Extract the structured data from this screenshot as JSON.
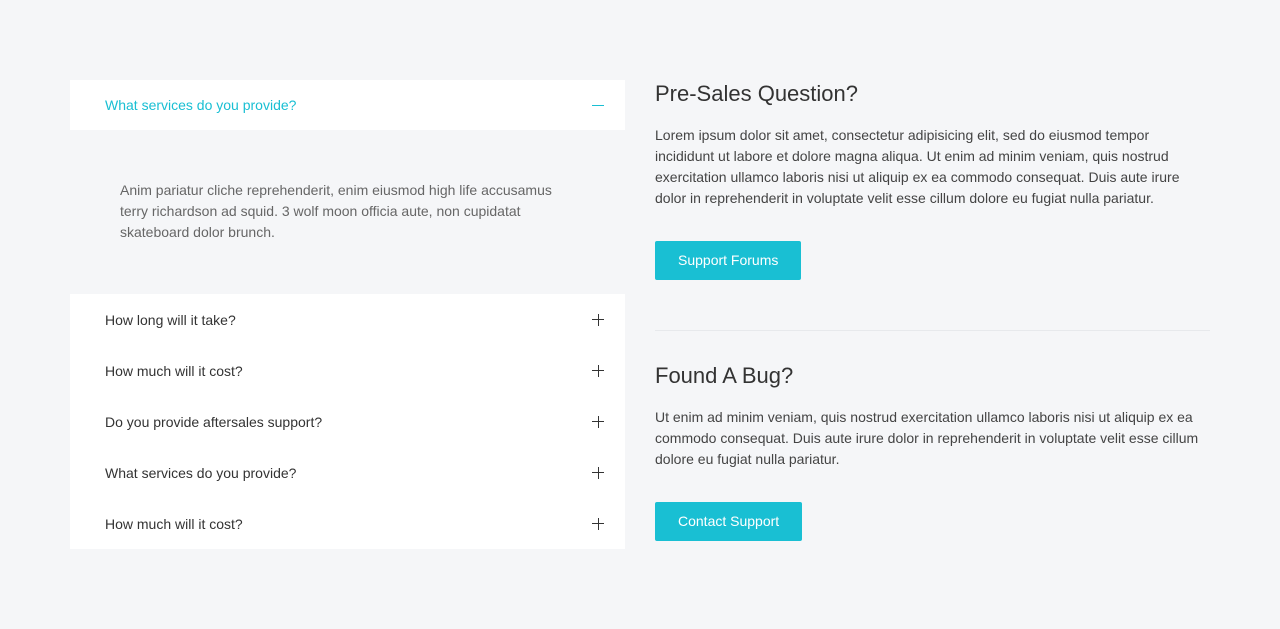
{
  "faq": {
    "active": {
      "question": "What services do you provide?",
      "answer": "Anim pariatur cliche reprehenderit, enim eiusmod high life accusamus terry richardson ad squid. 3 wolf moon officia aute, non cupidatat skateboard dolor brunch."
    },
    "items": [
      {
        "question": "How long will it take?"
      },
      {
        "question": "How much will it cost?"
      },
      {
        "question": "Do you provide aftersales support?"
      },
      {
        "question": "What services do you provide?"
      },
      {
        "question": "How much will it cost?"
      }
    ]
  },
  "presales": {
    "title": "Pre-Sales Question?",
    "text": "Lorem ipsum dolor sit amet, consectetur adipisicing elit, sed do eiusmod tempor incididunt ut labore et dolore magna aliqua. Ut enim ad minim veniam, quis nostrud exercitation ullamco laboris nisi ut aliquip ex ea commodo consequat. Duis aute irure dolor in reprehenderit in voluptate velit esse cillum dolore eu fugiat nulla pariatur.",
    "button_label": "Support Forums"
  },
  "bug": {
    "title": "Found A Bug?",
    "text": "Ut enim ad minim veniam, quis nostrud exercitation ullamco laboris nisi ut aliquip ex ea commodo consequat. Duis aute irure dolor in reprehenderit in voluptate velit esse cillum dolore eu fugiat nulla pariatur.",
    "button_label": "Contact Support"
  },
  "colors": {
    "accent": "#19bfd3",
    "background": "#f5f6f8"
  }
}
